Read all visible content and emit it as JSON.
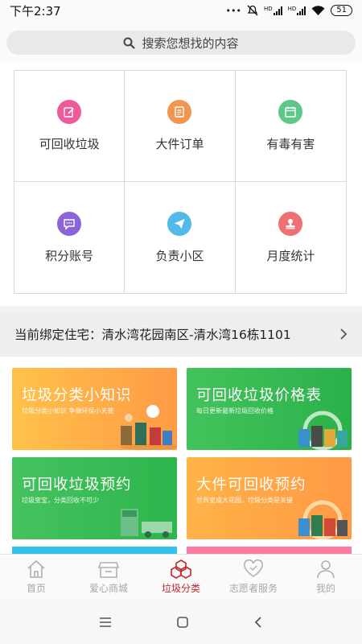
{
  "status_bar": {
    "time": "下午2:37",
    "signal1": "HD",
    "signal2": "HD",
    "battery": "51"
  },
  "search": {
    "placeholder": "搜索您想找的内容"
  },
  "grid": [
    {
      "label": "可回收垃圾",
      "icon": "edit-icon",
      "color": "#ef5a9a"
    },
    {
      "label": "大件订单",
      "icon": "document-icon",
      "color": "#f09650"
    },
    {
      "label": "有毒有害",
      "icon": "calendar-icon",
      "color": "#5ec78a"
    },
    {
      "label": "积分账号",
      "icon": "chat-icon",
      "color": "#8c63d9"
    },
    {
      "label": "负责小区",
      "icon": "paper-plane-icon",
      "color": "#53b9e8"
    },
    {
      "label": "月度统计",
      "icon": "stamp-icon",
      "color": "#ef6f72"
    }
  ],
  "binding": {
    "text": "当前绑定住宅：清水湾花园南区-清水湾16栋1101"
  },
  "banners": [
    {
      "title": "垃圾分类小知识",
      "subtitle": "垃圾分类小知识 争做环保小天使"
    },
    {
      "title": "可回收垃圾价格表",
      "subtitle": "每日更新最新垃圾回收价格"
    },
    {
      "title": "可回收垃圾预约",
      "subtitle": "垃圾变宝，分类回收不可少"
    },
    {
      "title": "大件可回收预约",
      "subtitle": "世界变成大花园，垃圾分类是关键"
    }
  ],
  "tabs": [
    {
      "label": "首页",
      "icon": "home-icon",
      "active": false
    },
    {
      "label": "爱心商城",
      "icon": "shop-icon",
      "active": false
    },
    {
      "label": "垃圾分类",
      "icon": "hexagon-icon",
      "active": true
    },
    {
      "label": "志愿者服务",
      "icon": "heart-icon",
      "active": false
    },
    {
      "label": "我的",
      "icon": "user-icon",
      "active": false
    }
  ],
  "colors": {
    "accent": "#c1272d"
  }
}
